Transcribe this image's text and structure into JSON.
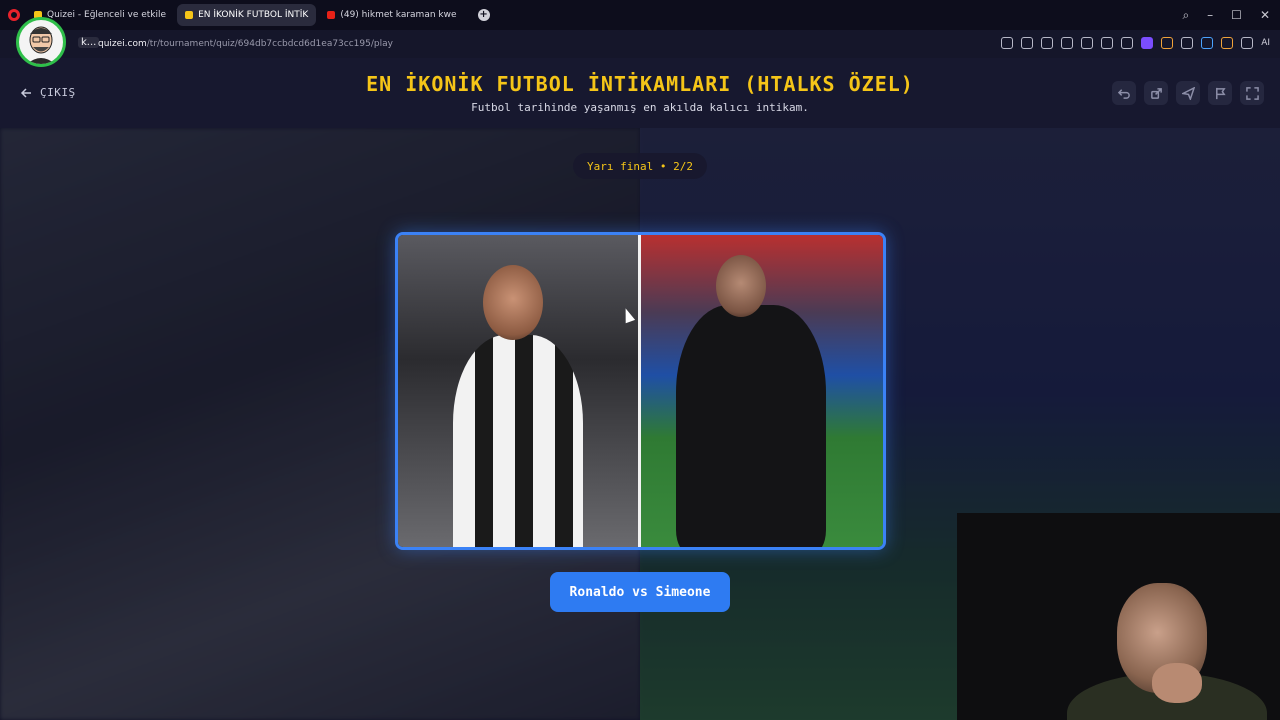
{
  "browser": {
    "tabs": [
      {
        "label": "Quizei - Eğlenceli ve etkile",
        "favicon_color": "#f5c518",
        "active": false
      },
      {
        "label": "EN İKONİK FUTBOL İNTİK",
        "favicon_color": "#f5c518",
        "active": true
      },
      {
        "label": "(49) hikmet karaman kwe",
        "favicon_color": "#e62117",
        "active": false
      }
    ],
    "new_tab": "+",
    "k_label": "k...",
    "url_domain": "quizei.com",
    "url_path": "/tr/tournament/quiz/694db7ccbdcd6d1ea73cc195/play",
    "ai_label": "AI"
  },
  "header": {
    "exit_label": "ÇIKIŞ",
    "title": "EN İKONİK FUTBOL İNTİKAMLARI (HTALKS ÖZEL)",
    "subtitle": "Futbol tarihinde yaşanmış en akılda kalıcı intikam."
  },
  "round": {
    "label": "Yarı final • 2/2"
  },
  "matchup": {
    "button_label": "Ronaldo vs Simeone",
    "accent_color": "#3b82f6"
  },
  "colors": {
    "title": "#f5c518",
    "button": "#2e7bf2"
  }
}
